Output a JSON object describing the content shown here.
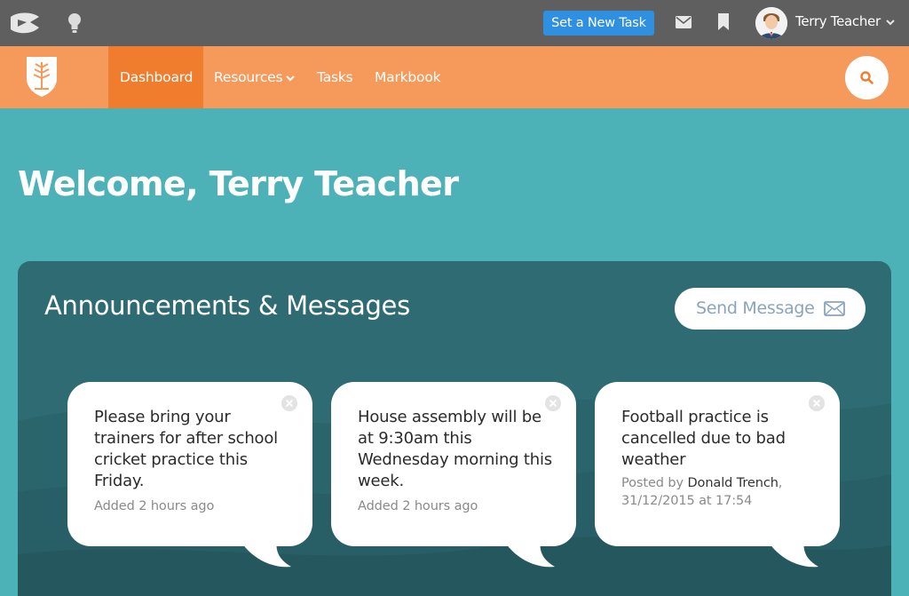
{
  "topbar": {
    "new_task_label": "Set a New Task",
    "user_name": "Terry Teacher",
    "icons": [
      "app-logo-icon",
      "lightbulb-icon",
      "mail-icon",
      "bookmark-icon",
      "chevron-down-icon"
    ]
  },
  "nav": {
    "items": [
      {
        "label": "Dashboard",
        "active": true
      },
      {
        "label": "Resources",
        "has_dropdown": true
      },
      {
        "label": "Tasks"
      },
      {
        "label": "Markbook"
      }
    ]
  },
  "welcome": {
    "title": "Welcome, Terry Teacher"
  },
  "announcements": {
    "title": "Announcements & Messages",
    "send_label": "Send Message",
    "cards": [
      {
        "text": "Please bring your trainers for after school cricket practice this Friday.",
        "meta": "Added 2 hours ago"
      },
      {
        "text": "House assembly will be at 9:30am this Wednesday morning this week.",
        "meta": "Added 2 hours ago"
      },
      {
        "text": "Football practice is cancelled due to bad weather",
        "posted_by_prefix": "Posted by",
        "posted_by_name": "Donald Trench",
        "posted_at": "31/12/2015 at 17:54"
      }
    ]
  },
  "colors": {
    "topbar": "#5f5f5f",
    "nav": "#f59a5b",
    "nav_active": "#f07d2e",
    "page_bg": "#4cb2b8",
    "panel": "#2e6b72",
    "primary_button": "#2f8fe0"
  }
}
